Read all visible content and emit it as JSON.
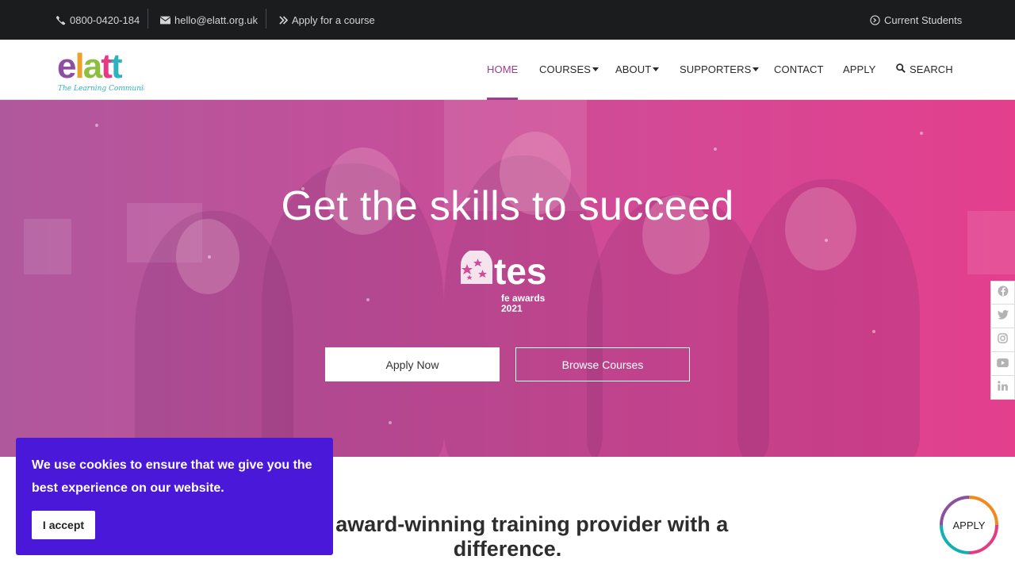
{
  "topbar": {
    "phone": "0800-0420-184",
    "email": "hello@elatt.org.uk",
    "apply_link": "Apply for a course",
    "current_students": "Current Students"
  },
  "logo": {
    "name": "elatt",
    "tagline": "The Learning Community"
  },
  "nav": {
    "home": "HOME",
    "courses": "COURSES",
    "about": "ABOUT",
    "supporters": "SUPPORTERS",
    "contact": "CONTACT",
    "apply": "APPLY",
    "search": "SEARCH",
    "active": "HOME",
    "active_color": "#9c3d8f"
  },
  "hero": {
    "title": "Get the skills to succeed",
    "award_brand": "tes",
    "award_line1": "fe awards",
    "award_line2": "2021",
    "apply_button": "Apply Now",
    "browse_button": "Browse Courses",
    "gradient_start": "#b0589c",
    "gradient_end": "#e33f8d"
  },
  "social": [
    "facebook-icon",
    "twitter-icon",
    "instagram-icon",
    "youtube-icon",
    "linkedin-icon"
  ],
  "intro": {
    "heading": "s an award-winning training provider with a difference."
  },
  "cookie": {
    "text": "We use cookies to ensure that we give you the best experience on our website.",
    "button": "I accept",
    "background": "#4a18d9"
  },
  "float_apply": {
    "label": "APPLY"
  }
}
